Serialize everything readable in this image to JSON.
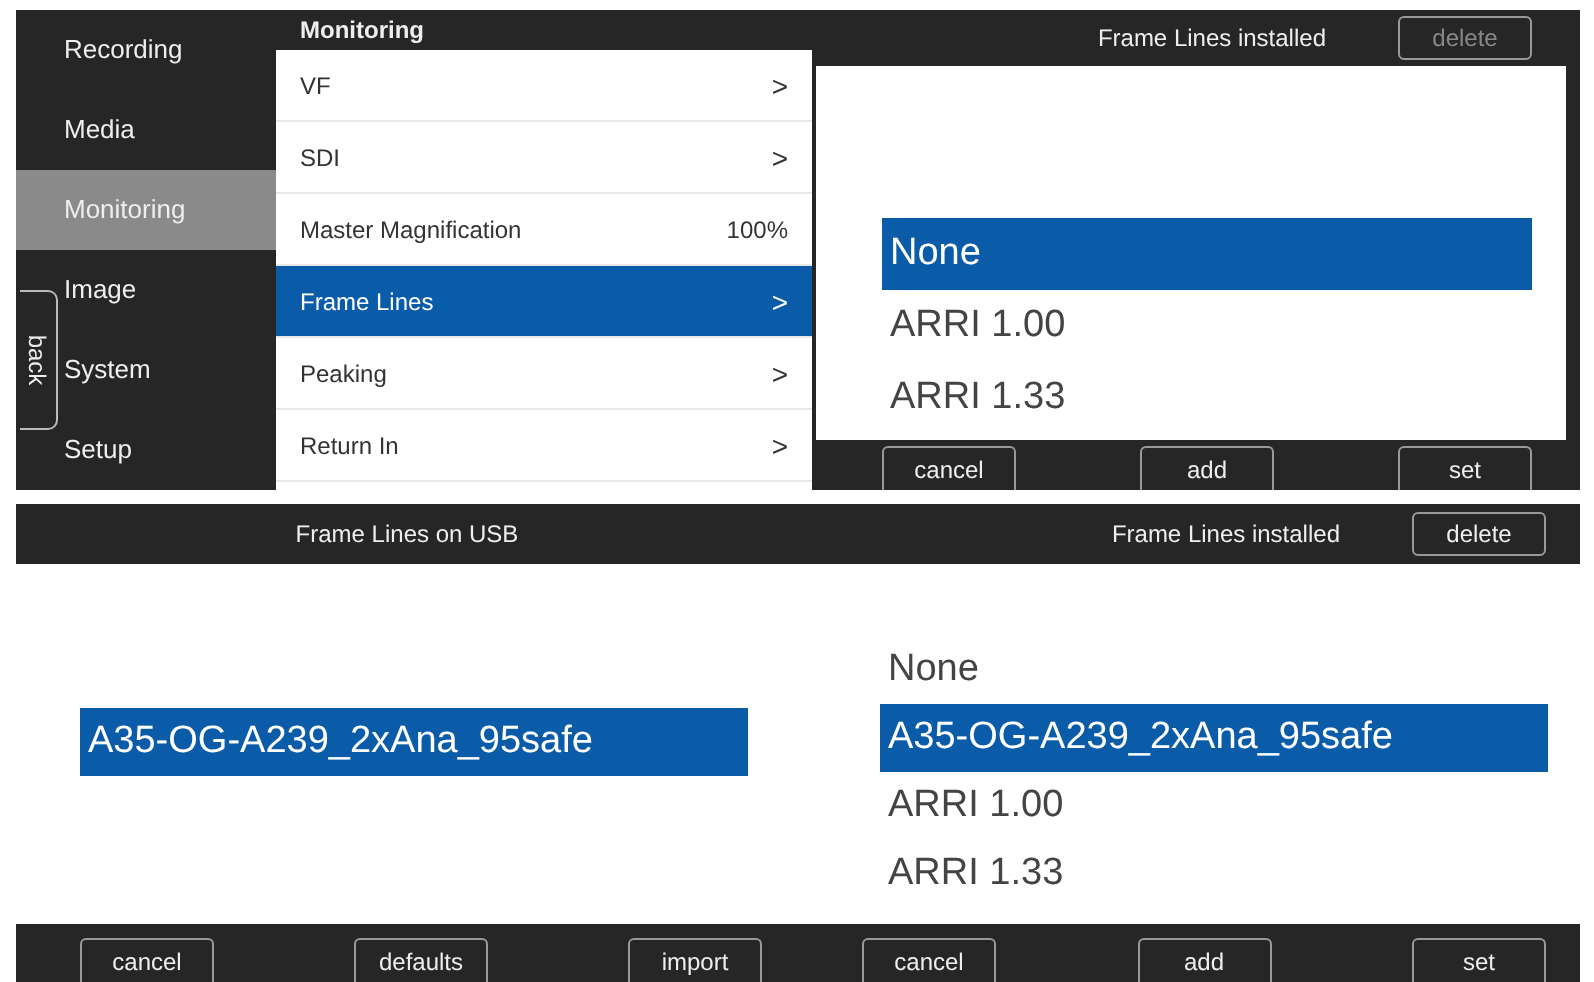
{
  "menu_screen": {
    "sidebar": {
      "items": [
        {
          "label": "Recording",
          "selected": false
        },
        {
          "label": "Media",
          "selected": false
        },
        {
          "label": "Monitoring",
          "selected": true
        },
        {
          "label": "Image",
          "selected": false
        },
        {
          "label": "System",
          "selected": false
        },
        {
          "label": "Setup",
          "selected": false
        }
      ],
      "back_tab": "back"
    },
    "menu": {
      "title": "Monitoring",
      "items": [
        {
          "label": "VF",
          "arrow": ">",
          "selected": false
        },
        {
          "label": "SDI",
          "arrow": ">",
          "selected": false
        },
        {
          "label": "Master Magnification",
          "value": "100%",
          "selected": false
        },
        {
          "label": "Frame Lines",
          "arrow": ">",
          "selected": true
        },
        {
          "label": "Peaking",
          "arrow": ">",
          "selected": false
        },
        {
          "label": "Return In",
          "arrow": ">",
          "selected": false
        }
      ]
    },
    "installed": {
      "title": "Frame Lines installed",
      "delete": {
        "label": "delete",
        "disabled": true
      },
      "items": [
        {
          "label": "None",
          "selected": true
        },
        {
          "label": "ARRI 1.00",
          "selected": false
        },
        {
          "label": "ARRI 1.33",
          "selected": false
        }
      ]
    },
    "buttons": [
      "cancel",
      "add",
      "set"
    ]
  },
  "usb_screen": {
    "usb": {
      "title": "Frame Lines on USB",
      "items": [
        {
          "label": "A35-OG-A239_2xAna_95safe",
          "selected": true
        }
      ]
    },
    "installed": {
      "title": "Frame Lines installed",
      "delete": {
        "label": "delete",
        "disabled": false
      },
      "items": [
        {
          "label": "None",
          "selected": false
        },
        {
          "label": "A35-OG-A239_2xAna_95safe",
          "selected": true
        },
        {
          "label": "ARRI 1.00",
          "selected": false
        },
        {
          "label": "ARRI 1.33",
          "selected": false
        }
      ]
    },
    "usb_buttons": [
      "cancel",
      "defaults",
      "import"
    ],
    "buttons": [
      "cancel",
      "add",
      "set"
    ]
  }
}
